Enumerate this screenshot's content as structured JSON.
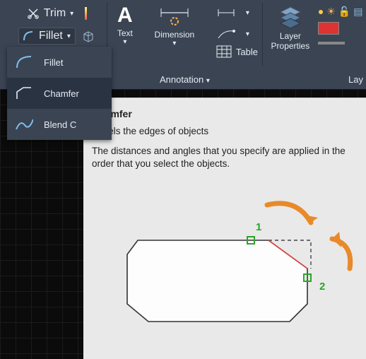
{
  "ribbon": {
    "trim_label": "Trim",
    "fillet_label": "Fillet",
    "text_label": "Text",
    "dimension_label": "Dimension",
    "table_label": "Table",
    "annotation_label": "Annotation",
    "layer_properties_label": "Layer\nProperties",
    "lay_label": "Lay"
  },
  "flyout": {
    "items": [
      {
        "label": "Fillet"
      },
      {
        "label": "Chamfer"
      },
      {
        "label": "Blend C"
      }
    ]
  },
  "tooltip": {
    "title": "Chamfer",
    "line1": "Bevels the edges of objects",
    "line2": "The distances and angles that you specify are applied in the order that you select the objects.",
    "step1": "1",
    "step2": "2"
  }
}
